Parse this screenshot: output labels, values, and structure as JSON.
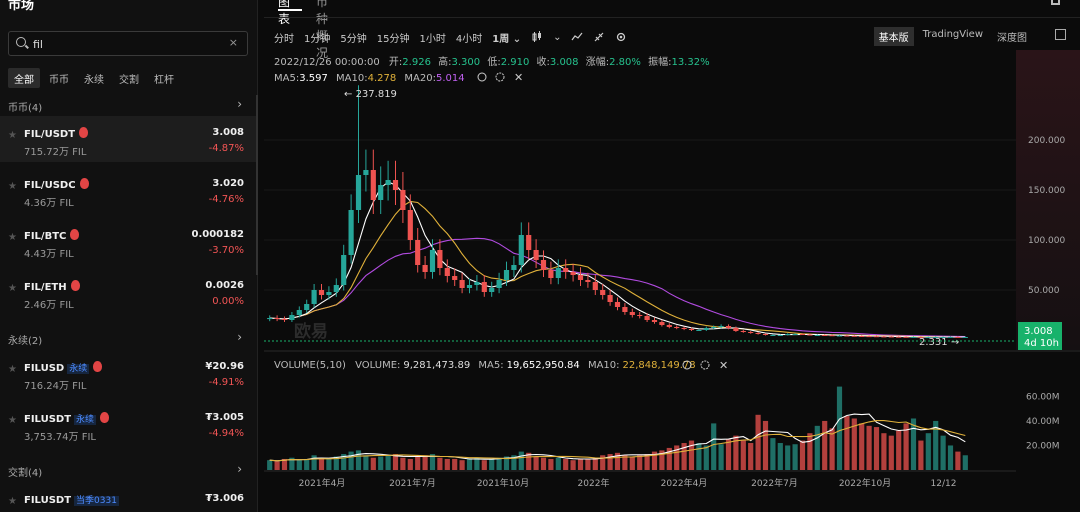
{
  "left_panel": {
    "title": "市场",
    "search": {
      "value": "fil",
      "clear": "×"
    },
    "filters": [
      "全部",
      "币币",
      "永续",
      "交割",
      "杠杆"
    ],
    "sections": [
      {
        "label": "币币(4)",
        "arrow": "›"
      },
      {
        "label": "永续(2)",
        "arrow": "›"
      },
      {
        "label": "交割(4)",
        "arrow": "›"
      }
    ],
    "items": [
      {
        "pair": "FIL/USDT",
        "tag": "",
        "vol": "715.72万 FIL",
        "price": "3.008",
        "change": "-4.87%"
      },
      {
        "pair": "FIL/USDC",
        "tag": "",
        "vol": "4.36万 FIL",
        "price": "3.020",
        "change": "-4.76%"
      },
      {
        "pair": "FIL/BTC",
        "tag": "",
        "vol": "4.43万 FIL",
        "price": "0.000182",
        "change": "-3.70%"
      },
      {
        "pair": "FIL/ETH",
        "tag": "",
        "vol": "2.46万 FIL",
        "price": "0.0026",
        "change": "0.00%"
      },
      {
        "pair": "FILUSD",
        "tag": "永续",
        "vol": "716.24万 FIL",
        "price": "¥20.96",
        "change": "-4.91%"
      },
      {
        "pair": "FILUSDT",
        "tag": "永续",
        "vol": "3,753.74万 FIL",
        "price": "₮3.005",
        "change": "-4.94%"
      },
      {
        "pair": "FILUSDT",
        "tag": "当季0331",
        "vol": "",
        "price": "₮3.006",
        "change": ""
      }
    ]
  },
  "right_panel": {
    "tabs": [
      "图表",
      "币种概况"
    ],
    "intervals": [
      "分时",
      "1分钟",
      "5分钟",
      "15分钟",
      "1小时",
      "4小时",
      "1周"
    ],
    "active_interval": "1周",
    "views": [
      "基本版",
      "TradingView",
      "深度图"
    ],
    "active_view": "基本版",
    "ohlc": {
      "date": "2022/12/26 00:00:00",
      "open_label": "开:",
      "open": "2.926",
      "high_label": "高:",
      "high": "3.300",
      "low_label": "低:",
      "low": "2.910",
      "close_label": "收:",
      "close": "3.008",
      "change_label": "涨幅:",
      "change": "2.80%",
      "amp_label": "振幅:",
      "amp": "13.32%"
    },
    "ma": {
      "ma5_label": "MA5:",
      "ma5": "3.597",
      "ma10_label": "MA10:",
      "ma10": "4.278",
      "ma20_label": "MA20:",
      "ma20": "5.014"
    },
    "volume": {
      "title": "VOLUME(5,10)",
      "vol_label": "VOLUME:",
      "vol": "9,281,473.89",
      "ma5_label": "MA5:",
      "ma5": "19,652,950.84",
      "ma10_label": "MA10:",
      "ma10": "22,848,149.78"
    },
    "max_label": "237.819",
    "min_label": "2.331",
    "last_price": "3.008",
    "countdown": "4d 10h",
    "watermark": "欧易",
    "colors": {
      "up": "#26a69a",
      "down": "#ef5350",
      "ma5": "#ffffff",
      "ma10": "#e0b13a",
      "ma20": "#b14be0",
      "last": "#18b26b"
    }
  },
  "chart_data": {
    "type": "candlestick",
    "interval": "1周",
    "y_ticks": [
      "200.000",
      "150.000",
      "100.000",
      "50.000"
    ],
    "ylim": [
      0,
      250
    ],
    "x_ticks": [
      "2021年4月",
      "2021年7月",
      "2021年10月",
      "2022年",
      "2022年4月",
      "2022年7月",
      "2022年10月",
      "12/12"
    ],
    "volume_ticks": [
      "60.00M",
      "40.00M",
      "20.00M"
    ],
    "volume_ylim": [
      0,
      75
    ],
    "closes": [
      22,
      21,
      20,
      25,
      30,
      36,
      50,
      45,
      48,
      55,
      85,
      130,
      165,
      170,
      140,
      155,
      160,
      150,
      130,
      100,
      75,
      68,
      90,
      72,
      64,
      60,
      52,
      55,
      58,
      48,
      52,
      60,
      70,
      75,
      105,
      90,
      80,
      70,
      62,
      72,
      68,
      65,
      60,
      58,
      50,
      45,
      38,
      33,
      28,
      25,
      24,
      20,
      18,
      15,
      13,
      12,
      11,
      10,
      10,
      12,
      13,
      14,
      12,
      9,
      8,
      7,
      6,
      5,
      5,
      5,
      6,
      6,
      5.5,
      5,
      5,
      4.8,
      4.5,
      4.5,
      4.2,
      4.0,
      3.9,
      3.8,
      3.6,
      3.5,
      3.3,
      3.2,
      3.0,
      3.1,
      2.9,
      2.9,
      3.0,
      3.0,
      3.1,
      2.9,
      3.0
    ],
    "volumes": [
      8,
      7,
      9,
      10,
      8,
      9,
      12,
      10,
      9,
      11,
      13,
      15,
      16,
      12,
      10,
      11,
      12,
      13,
      10,
      9,
      11,
      12,
      13,
      10,
      9,
      9,
      8,
      9,
      10,
      8,
      9,
      10,
      11,
      12,
      15,
      14,
      11,
      10,
      9,
      10,
      9,
      8,
      9,
      9,
      10,
      12,
      13,
      14,
      12,
      11,
      12,
      13,
      15,
      16,
      18,
      20,
      22,
      24,
      22,
      20,
      38,
      21,
      25,
      28,
      24,
      22,
      45,
      40,
      26,
      22,
      20,
      21,
      24,
      30,
      36,
      40,
      34,
      68,
      44,
      42,
      38,
      36,
      35,
      30,
      28,
      32,
      38,
      42,
      24,
      30,
      40,
      28,
      20,
      15,
      12
    ]
  }
}
